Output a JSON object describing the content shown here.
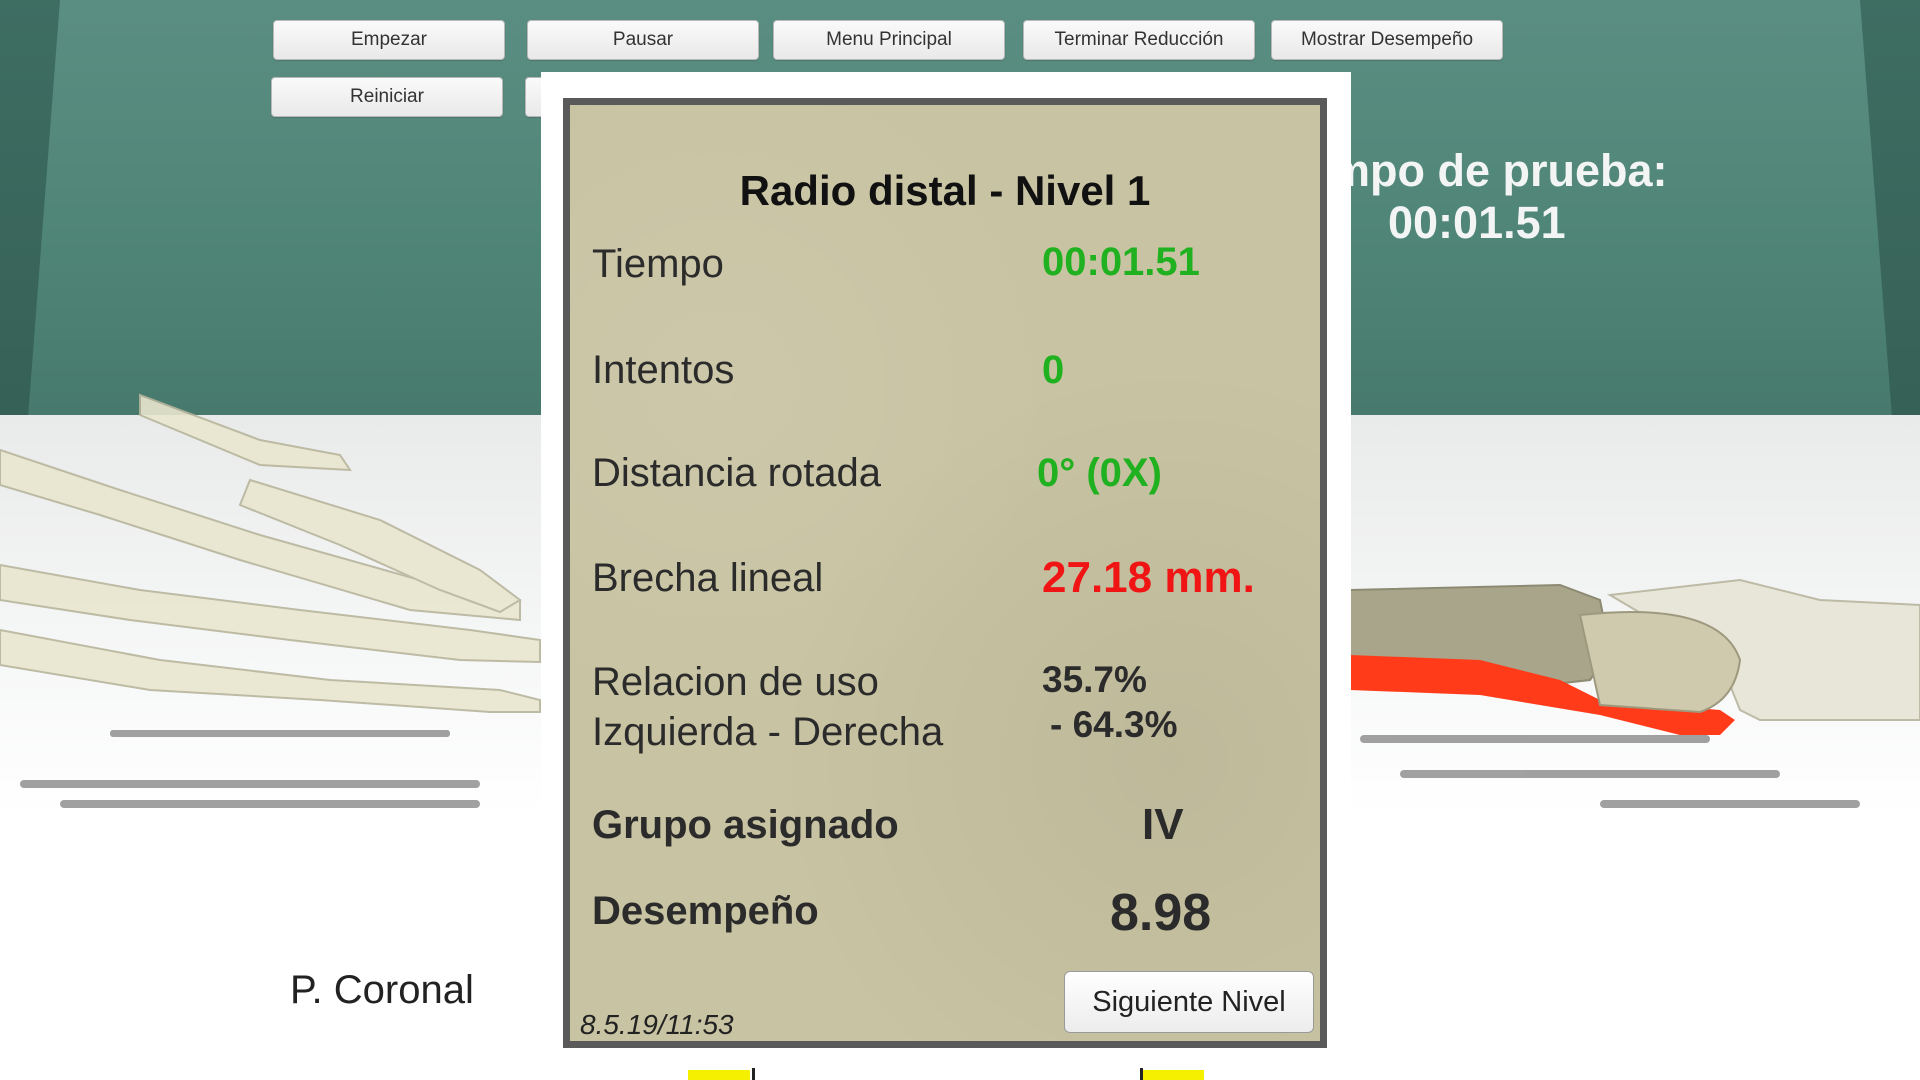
{
  "toolbar": {
    "start_label": "Empezar",
    "pause_label": "Pausar",
    "main_menu_label": "Menu Principal",
    "end_reduction_label": "Terminar Reducción",
    "show_performance_label": "Mostrar Desempeño",
    "restart_label": "Reiniciar"
  },
  "timer": {
    "label": "mpo de prueba:",
    "value": "00:01.51"
  },
  "view": {
    "plane_label": "P. Coronal"
  },
  "results": {
    "title": "Radio distal - Nivel 1",
    "time_label": "Tiempo",
    "time_value": "00:01.51",
    "attempts_label": "Intentos",
    "attempts_value": "0",
    "rotated_label": "Distancia rotada",
    "rotated_value": "0° (0X)",
    "gap_label": "Brecha lineal",
    "gap_value": "27.18 mm.",
    "usage_label_1": "Relacion de uso",
    "usage_label_2": "Izquierda - Derecha",
    "usage_value_1": "35.7%",
    "usage_value_2": "- 64.3%",
    "group_label": "Grupo asignado",
    "group_value": "IV",
    "performance_label": "Desempeño",
    "performance_value": "8.98",
    "date": "8.5.19/11:53",
    "next_level_label": "Siguiente Nivel"
  },
  "colors": {
    "good": "#1fb11f",
    "bad": "#f01414",
    "wall": "#4f8577",
    "panel": "#c8c3a2",
    "highlighted_bone": "#ff3b1a"
  }
}
